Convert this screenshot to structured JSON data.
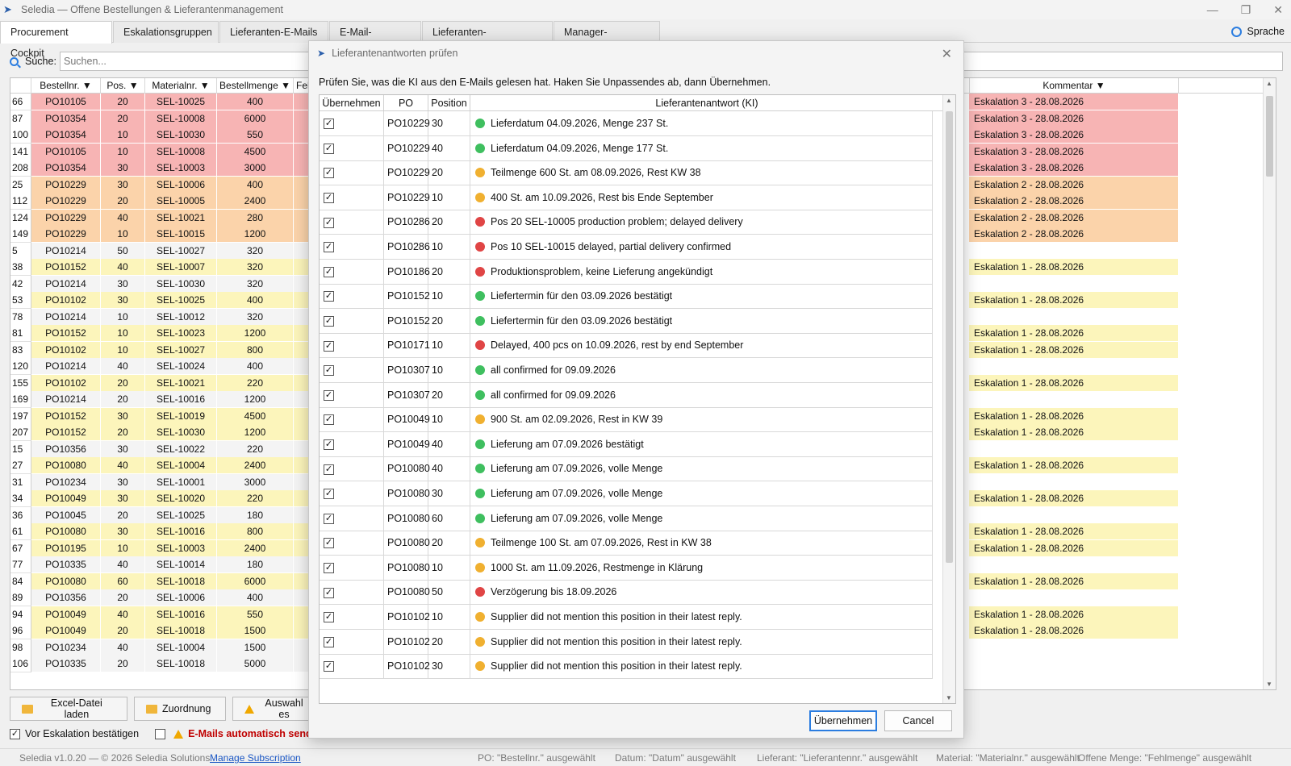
{
  "window": {
    "title": "Seledia — Offene Bestellungen & Lieferantenmanagement"
  },
  "tabs": [
    "Procurement Cockpit",
    "Eskalationsgruppen",
    "Lieferanten-E-Mails",
    "E-Mail-Vorlagen",
    "Lieferanten-Performance",
    "Manager-Übersicht"
  ],
  "language_label": "Sprache",
  "search": {
    "label": "Suche:",
    "placeholder": "Suchen..."
  },
  "grid": {
    "headers": {
      "bestellnr": "Bestellnr. ▼",
      "pos": "Pos. ▼",
      "material": "Materialnr. ▼",
      "menge": "Bestellmenge ▼",
      "fehl": "Fehl",
      "kommentar": "Kommentar ▼"
    },
    "rows": [
      {
        "idx": "66",
        "po": "PO10105",
        "pos": "20",
        "mat": "SEL-10025",
        "qty": "400",
        "com": "Eskalation 3 - 28.08.2026",
        "lvl": "esc3"
      },
      {
        "idx": "87",
        "po": "PO10354",
        "pos": "20",
        "mat": "SEL-10008",
        "qty": "6000",
        "com": "Eskalation 3 - 28.08.2026",
        "lvl": "esc3"
      },
      {
        "idx": "100",
        "po": "PO10354",
        "pos": "10",
        "mat": "SEL-10030",
        "qty": "550",
        "com": "Eskalation 3 - 28.08.2026",
        "lvl": "esc3"
      },
      {
        "idx": "141",
        "po": "PO10105",
        "pos": "10",
        "mat": "SEL-10008",
        "qty": "4500",
        "com": "Eskalation 3 - 28.08.2026",
        "lvl": "esc3"
      },
      {
        "idx": "208",
        "po": "PO10354",
        "pos": "30",
        "mat": "SEL-10003",
        "qty": "3000",
        "com": "Eskalation 3 - 28.08.2026",
        "lvl": "esc3"
      },
      {
        "idx": "25",
        "po": "PO10229",
        "pos": "30",
        "mat": "SEL-10006",
        "qty": "400",
        "com": "Eskalation 2 - 28.08.2026",
        "lvl": "esc2"
      },
      {
        "idx": "112",
        "po": "PO10229",
        "pos": "20",
        "mat": "SEL-10005",
        "qty": "2400",
        "com": "Eskalation 2 - 28.08.2026",
        "lvl": "esc2"
      },
      {
        "idx": "124",
        "po": "PO10229",
        "pos": "40",
        "mat": "SEL-10021",
        "qty": "280",
        "com": "Eskalation 2 - 28.08.2026",
        "lvl": "esc2"
      },
      {
        "idx": "149",
        "po": "PO10229",
        "pos": "10",
        "mat": "SEL-10015",
        "qty": "1200",
        "com": "Eskalation 2 - 28.08.2026",
        "lvl": "esc2"
      },
      {
        "idx": "5",
        "po": "PO10214",
        "pos": "50",
        "mat": "SEL-10027",
        "qty": "320",
        "com": "",
        "lvl": "none"
      },
      {
        "idx": "38",
        "po": "PO10152",
        "pos": "40",
        "mat": "SEL-10007",
        "qty": "320",
        "com": "Eskalation 1 - 28.08.2026",
        "lvl": "esc1"
      },
      {
        "idx": "42",
        "po": "PO10214",
        "pos": "30",
        "mat": "SEL-10030",
        "qty": "320",
        "com": "",
        "lvl": "none"
      },
      {
        "idx": "53",
        "po": "PO10102",
        "pos": "30",
        "mat": "SEL-10025",
        "qty": "400",
        "com": "Eskalation 1 - 28.08.2026",
        "lvl": "esc1"
      },
      {
        "idx": "78",
        "po": "PO10214",
        "pos": "10",
        "mat": "SEL-10012",
        "qty": "320",
        "com": "",
        "lvl": "none"
      },
      {
        "idx": "81",
        "po": "PO10152",
        "pos": "10",
        "mat": "SEL-10023",
        "qty": "1200",
        "com": "Eskalation 1 - 28.08.2026",
        "lvl": "esc1"
      },
      {
        "idx": "83",
        "po": "PO10102",
        "pos": "10",
        "mat": "SEL-10027",
        "qty": "800",
        "com": "Eskalation 1 - 28.08.2026",
        "lvl": "esc1"
      },
      {
        "idx": "120",
        "po": "PO10214",
        "pos": "40",
        "mat": "SEL-10024",
        "qty": "400",
        "com": "",
        "lvl": "none"
      },
      {
        "idx": "155",
        "po": "PO10102",
        "pos": "20",
        "mat": "SEL-10021",
        "qty": "220",
        "com": "Eskalation 1 - 28.08.2026",
        "lvl": "esc1"
      },
      {
        "idx": "169",
        "po": "PO10214",
        "pos": "20",
        "mat": "SEL-10016",
        "qty": "1200",
        "com": "",
        "lvl": "none"
      },
      {
        "idx": "197",
        "po": "PO10152",
        "pos": "30",
        "mat": "SEL-10019",
        "qty": "4500",
        "com": "Eskalation 1 - 28.08.2026",
        "lvl": "esc1"
      },
      {
        "idx": "207",
        "po": "PO10152",
        "pos": "20",
        "mat": "SEL-10030",
        "qty": "1200",
        "com": "Eskalation 1 - 28.08.2026",
        "lvl": "esc1"
      },
      {
        "idx": "15",
        "po": "PO10356",
        "pos": "30",
        "mat": "SEL-10022",
        "qty": "220",
        "com": "",
        "lvl": "none"
      },
      {
        "idx": "27",
        "po": "PO10080",
        "pos": "40",
        "mat": "SEL-10004",
        "qty": "2400",
        "com": "Eskalation 1 - 28.08.2026",
        "lvl": "esc1"
      },
      {
        "idx": "31",
        "po": "PO10234",
        "pos": "30",
        "mat": "SEL-10001",
        "qty": "3000",
        "com": "",
        "lvl": "none"
      },
      {
        "idx": "34",
        "po": "PO10049",
        "pos": "30",
        "mat": "SEL-10020",
        "qty": "220",
        "com": "Eskalation 1 - 28.08.2026",
        "lvl": "esc1"
      },
      {
        "idx": "36",
        "po": "PO10045",
        "pos": "20",
        "mat": "SEL-10025",
        "qty": "180",
        "com": "",
        "lvl": "none"
      },
      {
        "idx": "61",
        "po": "PO10080",
        "pos": "30",
        "mat": "SEL-10016",
        "qty": "800",
        "com": "Eskalation 1 - 28.08.2026",
        "lvl": "esc1"
      },
      {
        "idx": "67",
        "po": "PO10195",
        "pos": "10",
        "mat": "SEL-10003",
        "qty": "2400",
        "com": "Eskalation 1 - 28.08.2026",
        "lvl": "esc1"
      },
      {
        "idx": "77",
        "po": "PO10335",
        "pos": "40",
        "mat": "SEL-10014",
        "qty": "180",
        "com": "",
        "lvl": "none"
      },
      {
        "idx": "84",
        "po": "PO10080",
        "pos": "60",
        "mat": "SEL-10018",
        "qty": "6000",
        "com": "Eskalation 1 - 28.08.2026",
        "lvl": "esc1"
      },
      {
        "idx": "89",
        "po": "PO10356",
        "pos": "20",
        "mat": "SEL-10006",
        "qty": "400",
        "com": "",
        "lvl": "none"
      },
      {
        "idx": "94",
        "po": "PO10049",
        "pos": "40",
        "mat": "SEL-10016",
        "qty": "550",
        "com": "Eskalation 1 - 28.08.2026",
        "lvl": "esc1"
      },
      {
        "idx": "96",
        "po": "PO10049",
        "pos": "20",
        "mat": "SEL-10018",
        "qty": "1500",
        "com": "Eskalation 1 - 28.08.2026",
        "lvl": "esc1"
      },
      {
        "idx": "98",
        "po": "PO10234",
        "pos": "40",
        "mat": "SEL-10004",
        "qty": "1500",
        "com": "",
        "lvl": "none"
      },
      {
        "idx": "106",
        "po": "PO10335",
        "pos": "20",
        "mat": "SEL-10018",
        "qty": "5000",
        "com": "",
        "lvl": "none"
      }
    ]
  },
  "colors": {
    "esc3": "#f7b4b4",
    "esc2": "#fbd3aa",
    "esc1": "#fcf5bb",
    "none": "#f4f4f4",
    "green": "#3fbf5f",
    "orange": "#f0b030",
    "red": "#e04545",
    "accent": "#2b7de0"
  },
  "buttons": {
    "excel": "Excel-Datei laden",
    "mapping": "Zuordnung",
    "selection": "Auswahl es"
  },
  "checks": {
    "confirm": "Vor Eskalation bestätigen",
    "auto_mail": "E-Mails automatisch sender"
  },
  "status": {
    "version": "Seledia v1.0.20 — © 2026 Seledia Solutions",
    "manage": "Manage Subscription",
    "po": "PO: \"Bestellnr.\" ausgewählt",
    "date": "Datum: \"Datum\" ausgewählt",
    "supplier": "Lieferant: \"Lieferantennr.\" ausgewählt",
    "material": "Material: \"Materialnr.\" ausgewählt",
    "open_qty": "Offene Menge: \"Fehlmenge\" ausgewählt"
  },
  "dialog": {
    "title": "Lieferantenantworten prüfen",
    "instruction": "Prüfen Sie, was die KI aus den E-Mails gelesen hat. Haken Sie Unpassendes ab, dann Übernehmen.",
    "headers": {
      "take": "Übernehmen",
      "po": "PO",
      "position": "Position",
      "answer": "Lieferantenantwort (KI)"
    },
    "rows": [
      {
        "po": "PO10229",
        "pos": "30",
        "status": "green",
        "text": "Lieferdatum 04.09.2026, Menge 237 St."
      },
      {
        "po": "PO10229",
        "pos": "40",
        "status": "green",
        "text": "Lieferdatum 04.09.2026, Menge 177 St."
      },
      {
        "po": "PO10229",
        "pos": "20",
        "status": "orange",
        "text": "Teilmenge 600 St. am 08.09.2026, Rest KW 38"
      },
      {
        "po": "PO10229",
        "pos": "10",
        "status": "orange",
        "text": "400 St. am 10.09.2026, Rest bis Ende September"
      },
      {
        "po": "PO10286",
        "pos": "20",
        "status": "red",
        "text": "Pos 20 SEL-10005 production problem; delayed delivery"
      },
      {
        "po": "PO10286",
        "pos": "10",
        "status": "red",
        "text": "Pos 10 SEL-10015 delayed, partial delivery confirmed"
      },
      {
        "po": "PO10186",
        "pos": "20",
        "status": "red",
        "text": "Produktionsproblem, keine Lieferung angekündigt"
      },
      {
        "po": "PO10152",
        "pos": "10",
        "status": "green",
        "text": "Liefertermin für den 03.09.2026 bestätigt"
      },
      {
        "po": "PO10152",
        "pos": "20",
        "status": "green",
        "text": "Liefertermin für den 03.09.2026 bestätigt"
      },
      {
        "po": "PO10171",
        "pos": "10",
        "status": "red",
        "text": "Delayed, 400 pcs on 10.09.2026, rest by end September"
      },
      {
        "po": "PO10307",
        "pos": "10",
        "status": "green",
        "text": "all confirmed for 09.09.2026"
      },
      {
        "po": "PO10307",
        "pos": "20",
        "status": "green",
        "text": "all confirmed for 09.09.2026"
      },
      {
        "po": "PO10049",
        "pos": "10",
        "status": "orange",
        "text": "900 St. am 02.09.2026, Rest in KW 39"
      },
      {
        "po": "PO10049",
        "pos": "40",
        "status": "green",
        "text": "Lieferung am 07.09.2026 bestätigt"
      },
      {
        "po": "PO10080",
        "pos": "40",
        "status": "green",
        "text": "Lieferung am 07.09.2026, volle Menge"
      },
      {
        "po": "PO10080",
        "pos": "30",
        "status": "green",
        "text": "Lieferung am 07.09.2026, volle Menge"
      },
      {
        "po": "PO10080",
        "pos": "60",
        "status": "green",
        "text": "Lieferung am 07.09.2026, volle Menge"
      },
      {
        "po": "PO10080",
        "pos": "20",
        "status": "orange",
        "text": "Teilmenge 100 St. am 07.09.2026, Rest in KW 38"
      },
      {
        "po": "PO10080",
        "pos": "10",
        "status": "orange",
        "text": "1000 St. am 11.09.2026, Restmenge in Klärung"
      },
      {
        "po": "PO10080",
        "pos": "50",
        "status": "red",
        "text": "Verzögerung bis 18.09.2026"
      },
      {
        "po": "PO10102",
        "pos": "10",
        "status": "orange",
        "text": "Supplier did not mention this position in their latest reply."
      },
      {
        "po": "PO10102",
        "pos": "20",
        "status": "orange",
        "text": "Supplier did not mention this position in their latest reply."
      },
      {
        "po": "PO10102",
        "pos": "30",
        "status": "orange",
        "text": "Supplier did not mention this position in their latest reply."
      }
    ],
    "ok": "Übernehmen",
    "cancel": "Cancel"
  }
}
